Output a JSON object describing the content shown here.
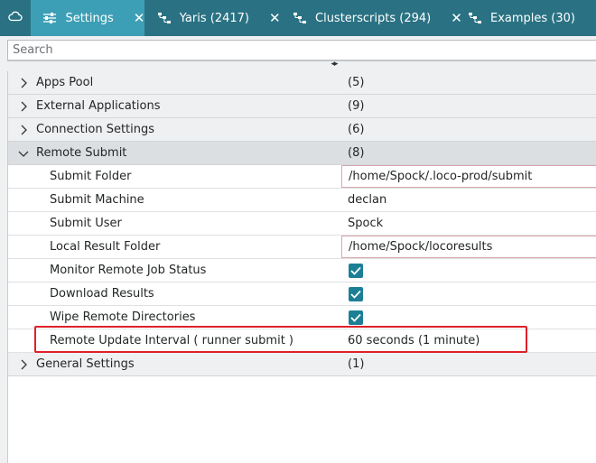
{
  "tabs": {
    "home_icon": "cloud-icon",
    "settings": {
      "label": "Settings",
      "icon": "sliders-icon",
      "close": "✕"
    },
    "yaris": {
      "label": "Yaris (2417)",
      "icon": "network-icon",
      "close": "✕"
    },
    "clusterscripts": {
      "label": "Clusterscripts (294)",
      "icon": "network-icon",
      "close": "✕"
    },
    "examples": {
      "label": "Examples (30)",
      "icon": "network-icon",
      "close": "✕"
    }
  },
  "search": {
    "placeholder": "Search"
  },
  "splitter_glyph": "◂▸",
  "tree": {
    "apps_pool": {
      "label": "Apps Pool",
      "count": "(5)"
    },
    "external_applications": {
      "label": "External Applications",
      "count": "(9)"
    },
    "connection_settings": {
      "label": "Connection Settings",
      "count": "(6)"
    },
    "remote_submit": {
      "label": "Remote Submit",
      "count": "(8)",
      "submit_folder": {
        "label": "Submit Folder",
        "value": "/home/Spock/.loco-prod/submit"
      },
      "submit_machine": {
        "label": "Submit Machine",
        "value": "declan"
      },
      "submit_user": {
        "label": "Submit User",
        "value": "Spock"
      },
      "local_result_folder": {
        "label": "Local Result Folder",
        "value": "/home/Spock/locoresults"
      },
      "monitor_remote_job_status": {
        "label": "Monitor Remote Job Status",
        "checked": true
      },
      "download_results": {
        "label": "Download Results",
        "checked": true
      },
      "wipe_remote_directories": {
        "label": "Wipe Remote Directories",
        "checked": true
      },
      "remote_update_interval": {
        "label": "Remote Update Interval ( runner submit )",
        "value": "60 seconds (1 minute)"
      }
    },
    "general_settings": {
      "label": "General Settings",
      "count": "(1)"
    }
  },
  "colors": {
    "tabbar": "#2a7283",
    "active_tab": "#3d9fb5",
    "checkbox": "#1d7f95",
    "highlight": "#e0202a"
  }
}
